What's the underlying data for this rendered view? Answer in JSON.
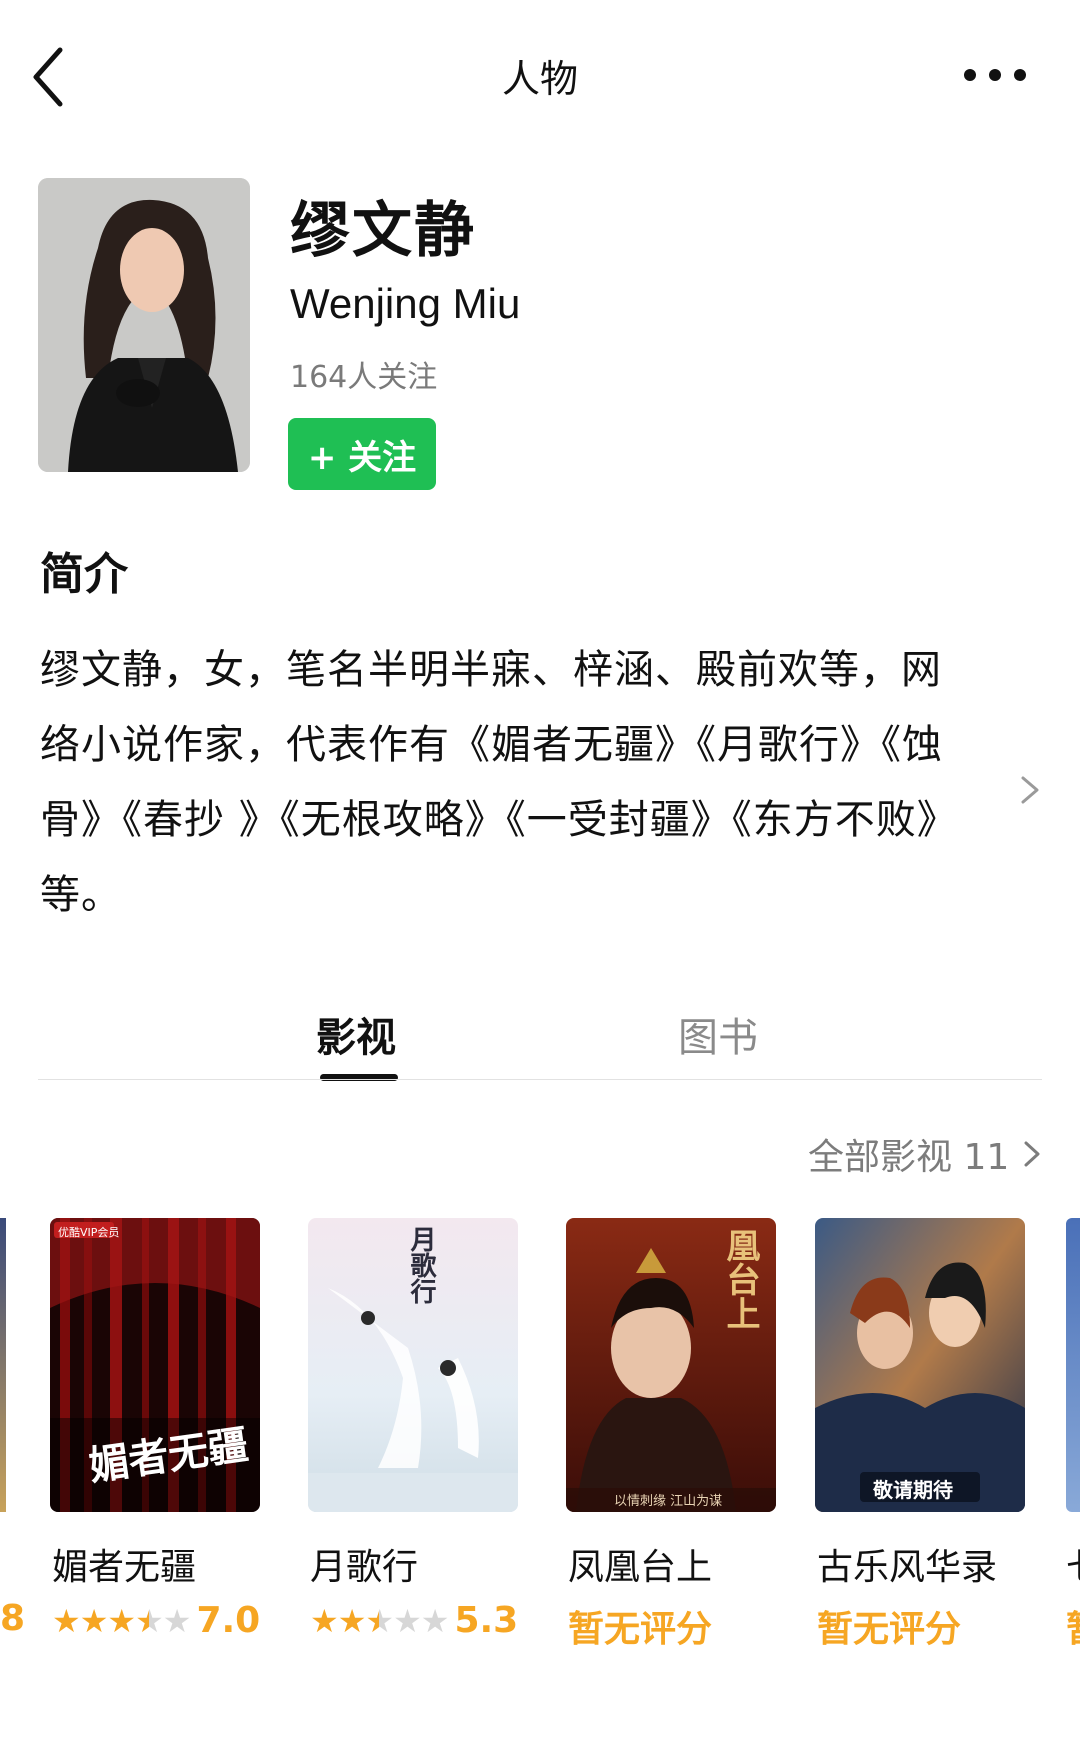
{
  "nav": {
    "title": "人物",
    "back_icon": "chevron-left-icon",
    "more_icon": "more-dots-icon"
  },
  "profile": {
    "name_cn": "缪文静",
    "name_en": "Wenjing Miu",
    "followers": "164人关注",
    "follow_label": "+ 关注",
    "follow_color": "#1fbf54"
  },
  "intro": {
    "heading": "简介",
    "text": "缪文静，女，笔名半明半寐、梓涵、殿前欢等，网络小说作家，代表作有《媚者无疆》《月歌行》《蚀骨》《春抄 》《无根攻略》《一受封疆》《东方不败》等。"
  },
  "tabs": [
    {
      "label": "影视",
      "active": true
    },
    {
      "label": "图书",
      "active": false
    }
  ],
  "all_link": "全部影视 11",
  "accent_color": "#f6a623",
  "movies": [
    {
      "title": "媚者无疆",
      "stars": 3.5,
      "score": "7.0",
      "poster_text": "媚者无疆",
      "badge": "优酷VIP会员"
    },
    {
      "title": "月歌行",
      "stars": 2.5,
      "score": "5.3",
      "poster_text": "月歌行"
    },
    {
      "title": "凤凰台上",
      "score_text": "暂无评分",
      "poster_text": "凰台上",
      "poster_caption": "以情刺缘  江山为谋"
    },
    {
      "title": "古乐风华录",
      "score_text": "暂无评分",
      "poster_badge": "敬请期待"
    }
  ],
  "edge": {
    "left_score": "8",
    "right_title": "七",
    "right_score": "暂"
  }
}
